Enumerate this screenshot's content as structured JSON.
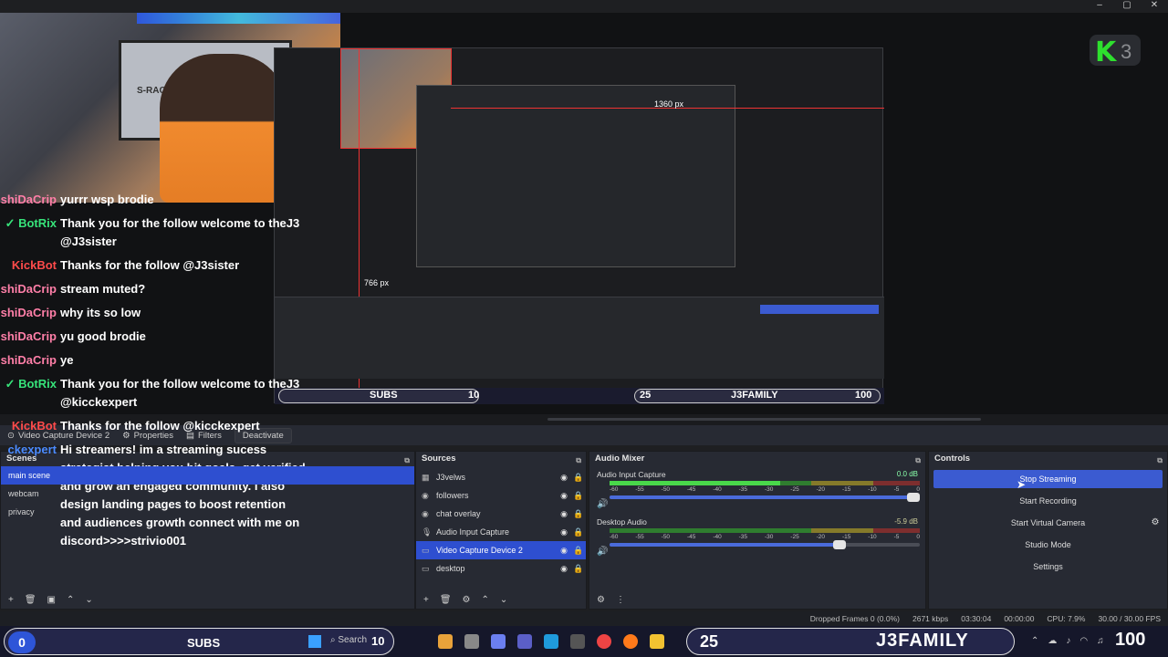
{
  "window": {
    "minimize": "–",
    "maximize": "▢",
    "close": "✕"
  },
  "preview": {
    "webcam_tv_label": "S-RACER",
    "measure_h": "1360 px",
    "measure_v": "766 px",
    "logo_letter": "K",
    "logo_num": "3",
    "nested_25": "25",
    "nested_family": "J3FAMILY",
    "nested_100": "100",
    "nested_subs": "SUBS",
    "nested_10": "10"
  },
  "chat": [
    {
      "user": "shiDaCrip",
      "text": "yurrr wsp brodie",
      "color": "#ff7fa8"
    },
    {
      "user": "BotRix",
      "text": "Thank you for the follow welcome to theJ3 @J3sister",
      "color": "#37e37a",
      "verified": true
    },
    {
      "user": "KickBot",
      "text": "Thanks for the follow @J3sister",
      "color": "#ff4b4b"
    },
    {
      "user": "shiDaCrip",
      "text": "stream muted?",
      "color": "#ff7fa8"
    },
    {
      "user": "shiDaCrip",
      "text": "why its so low",
      "color": "#ff7fa8"
    },
    {
      "user": "shiDaCrip",
      "text": "yu good brodie",
      "color": "#ff7fa8"
    },
    {
      "user": "shiDaCrip",
      "text": "ye",
      "color": "#ff7fa8"
    },
    {
      "user": "BotRix",
      "text": "Thank you for the follow welcome to theJ3 @kicckexpert",
      "color": "#37e37a",
      "verified": true
    },
    {
      "user": "KickBot",
      "text": "Thanks for the follow @kicckexpert",
      "color": "#ff4b4b"
    },
    {
      "user": "ckexpert",
      "text": "Hi streamers! im a streaming sucess strategist helping you hit goals, get verified and grow an engaged community. i also design landing pages to boost retention and audiences growth connect with me on discord>>>>strivio001",
      "color": "#4b8bff"
    }
  ],
  "toolbar": {
    "source_name": "Video Capture Device 2",
    "properties": "Properties",
    "filters": "Filters",
    "deactivate": "Deactivate"
  },
  "scenes": {
    "title": "Scenes",
    "items": [
      "main scene",
      "webcam",
      "privacy"
    ],
    "active": 0
  },
  "sources": {
    "title": "Sources",
    "items": [
      {
        "label": "J3velws",
        "icon": "▦"
      },
      {
        "label": "followers",
        "icon": "◉"
      },
      {
        "label": "chat overlay",
        "icon": "◉"
      },
      {
        "label": "Audio Input Capture",
        "icon": "🎙"
      },
      {
        "label": "Video Capture Device 2",
        "icon": "▭"
      },
      {
        "label": "desktop",
        "icon": "▭"
      }
    ],
    "active": 4
  },
  "mixer": {
    "title": "Audio Mixer",
    "channels": [
      {
        "name": "Audio Input Capture",
        "db": "0.0 dB",
        "level": 0.55,
        "volume": 0.98
      },
      {
        "name": "Desktop Audio",
        "db": "-5.9 dB",
        "level": 0.0,
        "volume": 0.74
      }
    ],
    "ticks": [
      "-60",
      "-55",
      "-50",
      "-45",
      "-40",
      "-35",
      "-30",
      "-25",
      "-20",
      "-15",
      "-10",
      "-5",
      "0"
    ]
  },
  "controls": {
    "title": "Controls",
    "stop_streaming": "Stop Streaming",
    "start_recording": "Start Recording",
    "start_virtual_camera": "Start Virtual Camera",
    "studio_mode": "Studio Mode",
    "settings": "Settings"
  },
  "status": {
    "dropped": "Dropped Frames 0 (0.0%)",
    "bitrate": "2671 kbps",
    "stream_time": "03:30:04",
    "rec_time": "00:00:00",
    "cpu": "CPU: 7.9%",
    "fps": "30.00 / 30.00 FPS"
  },
  "taskbar": {
    "circle": "0",
    "subs": "SUBS",
    "ten": "10",
    "search": "Search",
    "num25": "25",
    "family": "J3FAMILY",
    "hundred": "100"
  }
}
